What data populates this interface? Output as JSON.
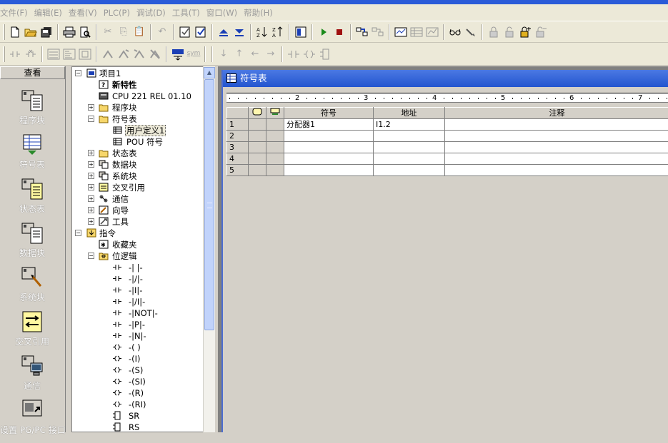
{
  "menu": [
    "文件(F)",
    "编辑(E)",
    "查看(V)",
    "PLC(P)",
    "调试(D)",
    "工具(T)",
    "窗口(W)",
    "帮助(H)"
  ],
  "navbar": {
    "title": "查看",
    "items": [
      "程序块",
      "符号表",
      "状态表",
      "数据块",
      "系统块",
      "交叉引用",
      "通信",
      "设置 PG/PC 接口"
    ]
  },
  "tree": {
    "project": "项目1",
    "new_features": "新特性",
    "cpu": "CPU 221 REL 01.10",
    "program_block": "程序块",
    "symbol_table": "符号表",
    "user_defined": "用户定义1",
    "pou_symbols": "POU 符号",
    "status_table": "状态表",
    "data_block": "数据块",
    "system_block": "系统块",
    "cross_reference": "交叉引用",
    "communication": "通信",
    "wizard": "向导",
    "tools": "工具",
    "instructions": "指令",
    "favorites": "收藏夹",
    "bit_logic": "位逻辑",
    "bit_items": [
      "-| |-",
      "-|/|-",
      "-|I|-",
      "-|/I|-",
      "-|NOT|-",
      "-|P|-",
      "-|N|-",
      "-( )",
      "-(I)",
      "-(S)",
      "-(SI)",
      "-(R)",
      "-(RI)",
      "SR",
      "RS"
    ]
  },
  "symbol_window": {
    "title": "符号表",
    "ruler_numbers": [
      "2",
      "3",
      "4",
      "5",
      "6",
      "7"
    ],
    "columns": [
      "符号",
      "地址",
      "注释"
    ],
    "rows": [
      {
        "num": "1",
        "symbol": "分配器1",
        "address": "I1.2",
        "comment": ""
      },
      {
        "num": "2",
        "symbol": "",
        "address": "",
        "comment": ""
      },
      {
        "num": "3",
        "symbol": "",
        "address": "",
        "comment": ""
      },
      {
        "num": "4",
        "symbol": "",
        "address": "",
        "comment": ""
      },
      {
        "num": "5",
        "symbol": "",
        "address": "",
        "comment": ""
      }
    ]
  },
  "toolbar": {
    "sym_label": "sym"
  },
  "colors": {
    "title_bar": "#2a5bd8",
    "face": "#d4d0c8",
    "mdi_background": "#808080"
  }
}
